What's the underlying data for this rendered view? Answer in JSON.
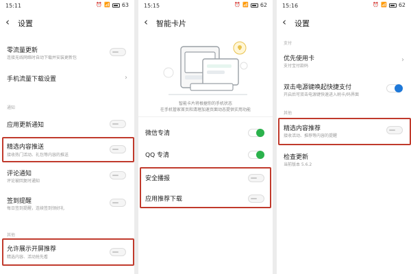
{
  "panel1": {
    "status": {
      "time": "15:11",
      "battery": "63"
    },
    "title": "设置",
    "items": [
      {
        "label": "零流量更新",
        "sub": "连接无线网络时自动下载并安装更新包"
      },
      {
        "label": "手机流量下载设置"
      },
      {
        "section": "通知"
      },
      {
        "label": "应用更新通知"
      },
      {
        "label": "精选内容推送",
        "sub": "接收热门活动、礼包等内容的推送"
      },
      {
        "label": "评论通知",
        "sub": "评论被回复时通知"
      },
      {
        "label": "签到提醒",
        "sub": "每日签到提醒，连续签到领好礼"
      },
      {
        "section": "其他"
      },
      {
        "label": "允许展示开屏推荐",
        "sub": "精选内容、活动抢先看"
      }
    ]
  },
  "panel2": {
    "status": {
      "time": "15:15",
      "battery": "62"
    },
    "title": "智能卡片",
    "caption1": "智能卡片将根据你的手机状态",
    "caption2": "在手机管家首页和清理加速页面动态提供实用功能",
    "items": [
      {
        "label": "微信专清"
      },
      {
        "label": "QQ 专清"
      },
      {
        "label": "安全播报"
      },
      {
        "label": "应用推荐下载"
      }
    ]
  },
  "panel3": {
    "status": {
      "time": "15:16",
      "battery": "62"
    },
    "title": "设置",
    "items": [
      {
        "section": "支付"
      },
      {
        "label": "优先使用卡",
        "sub": "支付宝付款码"
      },
      {
        "label": "双击电源键唤起快捷支付",
        "sub": "开启后可双击电源键快速进入刷卡/码界面"
      },
      {
        "section": "其他"
      },
      {
        "label": "精选内容推荐",
        "sub": "接收活动、推荐等内容的提醒"
      },
      {
        "label": "检查更新",
        "sub": "当前版本 5.6.2"
      }
    ]
  },
  "colors": {
    "highlight": "#c0392b",
    "toggle_green": "#2bb24c",
    "toggle_blue": "#1e78d8"
  },
  "icons": [
    "back-arrow-icon",
    "chevron-right-icon",
    "wifi-icon",
    "signal-icon",
    "battery-icon",
    "alarm-icon",
    "bulb-icon"
  ]
}
